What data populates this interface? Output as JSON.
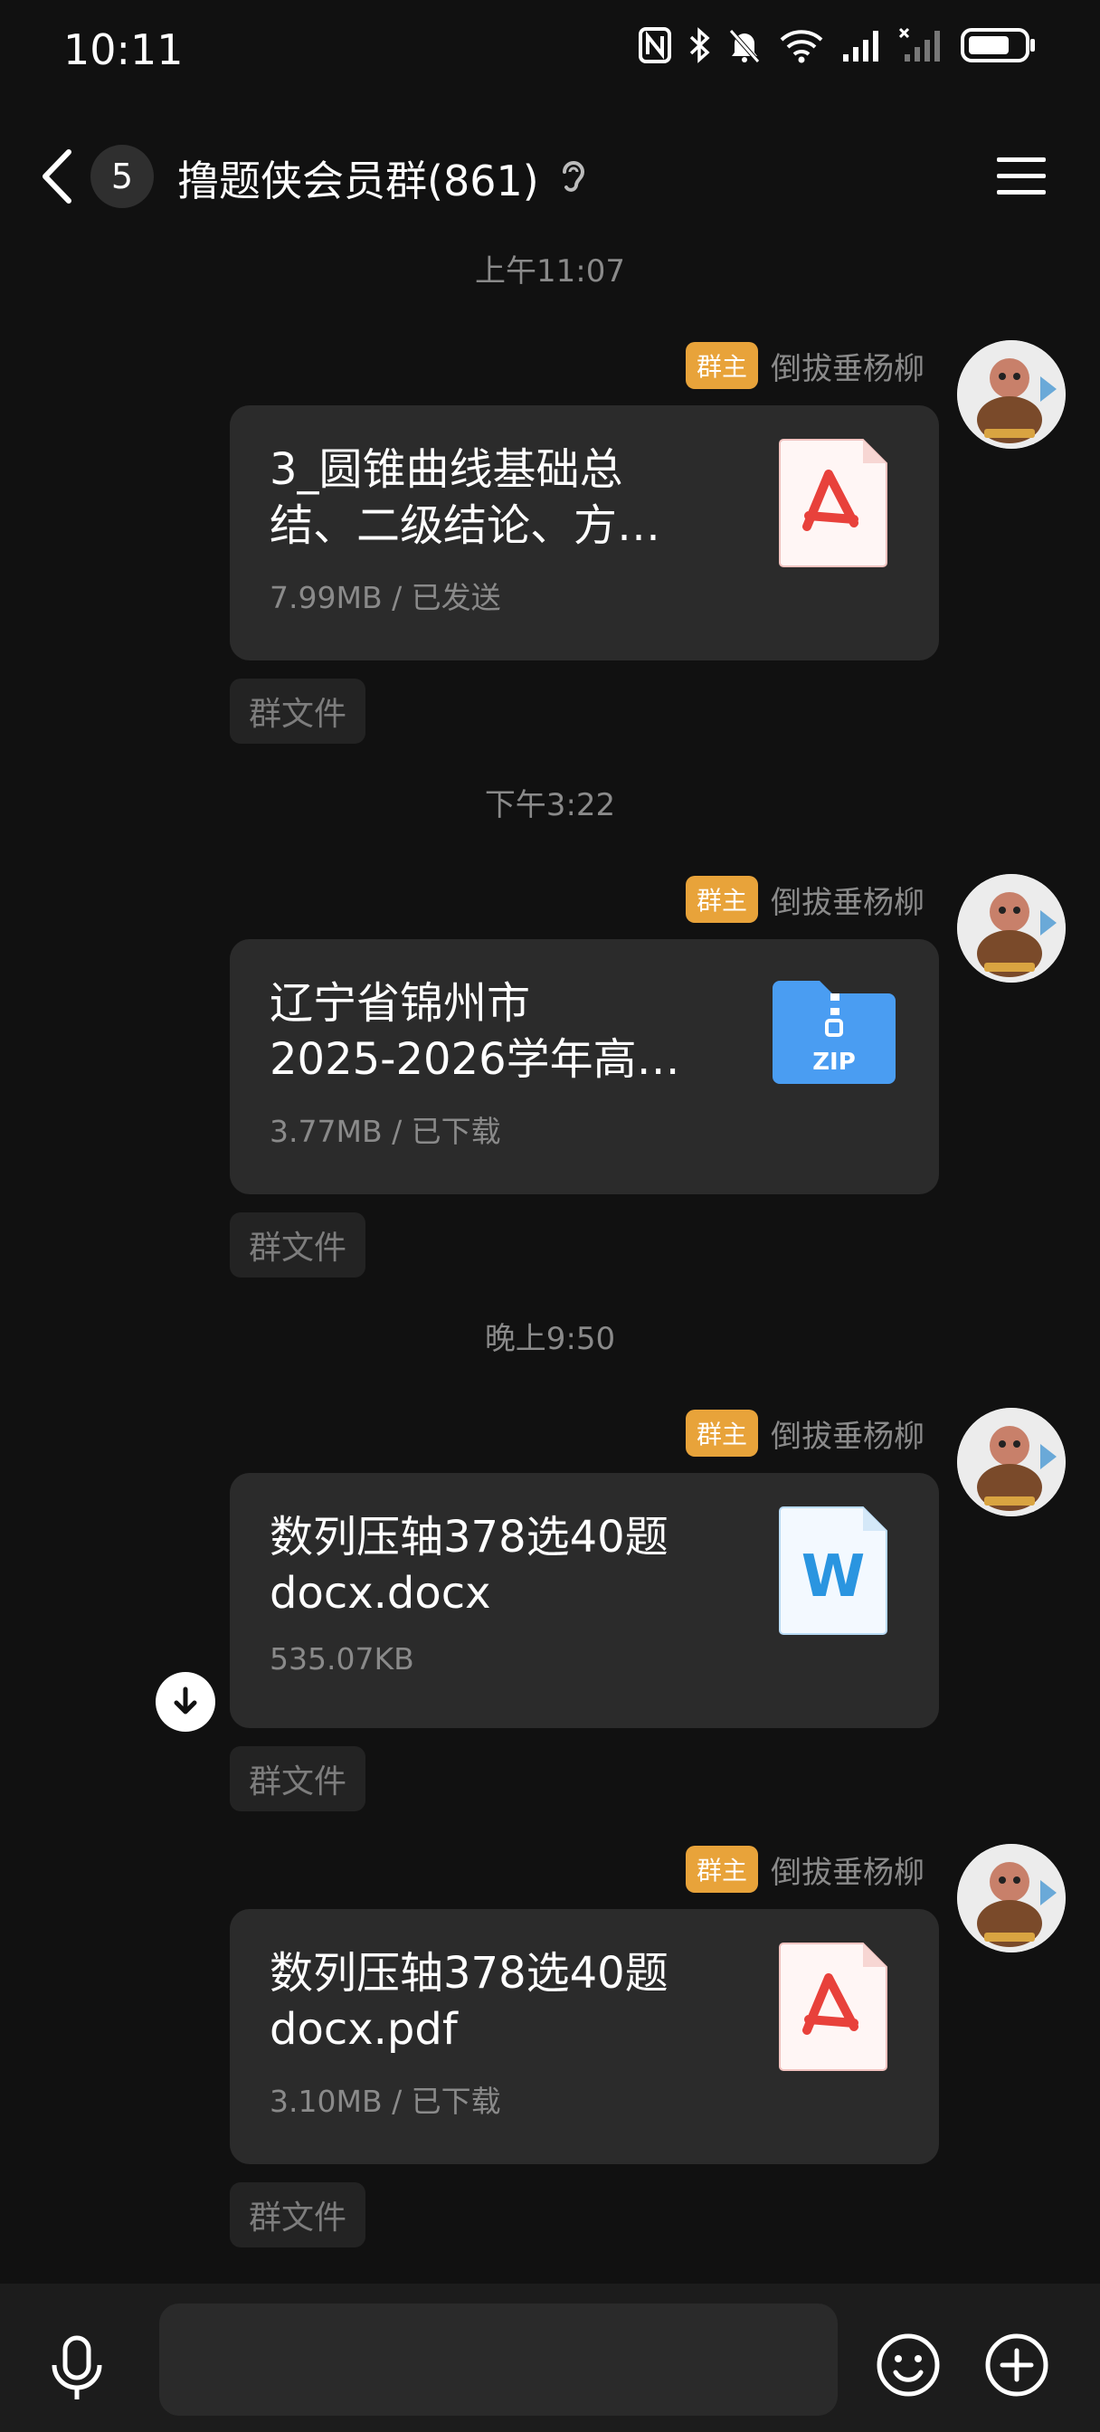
{
  "status_bar": {
    "time": "10:11",
    "icons": [
      "nfc-icon",
      "bluetooth-icon",
      "mute-icon",
      "wifi-icon",
      "signal-icon",
      "signal-off-icon",
      "battery-icon"
    ]
  },
  "header": {
    "back_label": "5",
    "title": "撸题侠会员群(861)",
    "ear_icon": "ear-icon",
    "menu_icon": "menu-icon"
  },
  "messages": [
    {
      "timestamp": "上午11:07",
      "badge": "群主",
      "sender": "倒拔垂杨柳",
      "file_name": "3_圆锥曲线基础总\n结、二级结论、方…",
      "file_meta": "7.99MB / 已发送",
      "file_type": "pdf",
      "tag": "群文件"
    },
    {
      "timestamp": "下午3:22",
      "badge": "群主",
      "sender": "倒拔垂杨柳",
      "file_name": "辽宁省锦州市\n2025-2026学年高…",
      "file_meta": "3.77MB / 已下载",
      "file_type": "zip",
      "zip_label": "ZIP",
      "tag": "群文件"
    },
    {
      "timestamp": "晚上9:50",
      "badge": "群主",
      "sender": "倒拔垂杨柳",
      "file_name": "数列压轴378选40题\ndocx.docx",
      "file_meta": "535.07KB",
      "file_type": "word",
      "word_label": "W",
      "tag": "群文件"
    },
    {
      "badge": "群主",
      "sender": "倒拔垂杨柳",
      "file_name": "数列压轴378选40题\ndocx.pdf",
      "file_meta": "3.10MB / 已下载",
      "file_type": "pdf",
      "tag": "群文件"
    }
  ],
  "input_bar": {
    "placeholder": "",
    "icons": [
      "microphone-icon",
      "emoji-icon",
      "plus-icon"
    ]
  },
  "colors": {
    "background": "#111111",
    "bubble": "#2b2b2b",
    "owner_badge": "#e8a33a",
    "pdf_red": "#e8413b",
    "zip_blue": "#4a9df2",
    "word_blue": "#2a95e0"
  }
}
